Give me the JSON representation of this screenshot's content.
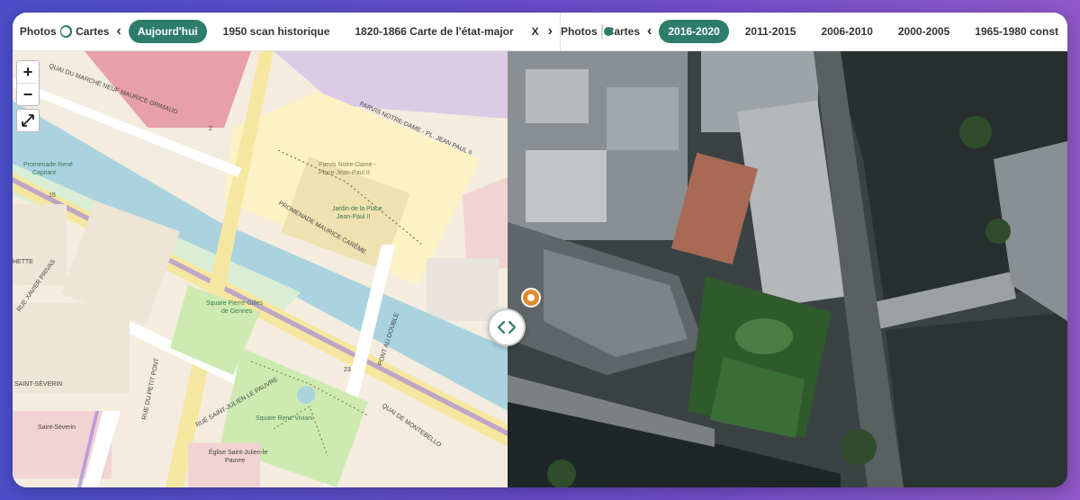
{
  "left_toolbar": {
    "photos_label": "Photos",
    "cartes_label": "Cartes",
    "tabs": [
      {
        "label": "Aujourd'hui",
        "active": true
      },
      {
        "label": "1950 scan historique",
        "active": false
      },
      {
        "label": "1820-1866 Carte de l'état-major",
        "active": false
      },
      {
        "label": "X",
        "active": false
      }
    ]
  },
  "right_toolbar": {
    "photos_label": "Photos",
    "cartes_label": "Cartes",
    "tabs": [
      {
        "label": "2016-2020",
        "active": true
      },
      {
        "label": "2011-2015",
        "active": false
      },
      {
        "label": "2006-2010",
        "active": false
      },
      {
        "label": "2000-2005",
        "active": false
      },
      {
        "label": "1965-1980 const",
        "active": false
      }
    ]
  },
  "map_controls": {
    "zoom_in": "+",
    "zoom_out": "−"
  },
  "map_labels": {
    "quai_marche_neuf": "QUAI DU MARCHÉ NEUF MAURICE GRIMAUD",
    "parvis": "PARVIS NOTRE-DAME - PL. JEAN PAUL II",
    "parvis_place_1": "Parvis Notre-Dame -",
    "parvis_place_2": "Place Jean-Paul II",
    "jardin_1": "Jardin de la Place",
    "jardin_2": "Jean-Paul II",
    "promenade_carene": "PROMENADE MAURICE CARÊME",
    "promenade_rene_1": "Promenade René",
    "promenade_rene_2": "Capitant",
    "rue_petit_pont": "RUE DU PETIT PONT",
    "rue_st_julien": "RUE SAINT-JULIEN LE PAUVRE",
    "square_gilles_1": "Square Pierre-Gilles",
    "square_gilles_2": "de Gennes",
    "square_viviani": "Square René Viviani",
    "pont_double": "PONT AU DOUBLE",
    "quai_montebello": "QUAI DE MONTEBELLO",
    "huchette": "HETTE",
    "rue_prouvaires": "RUE XAVIER PRIVAS",
    "saint_severin": "SAINT-SÉVERIN",
    "saint_severin_church": "Saint-Séverin",
    "eglise_1": "Église Saint-Julien-le",
    "eglise_2": "Pauvre",
    "num_15": "15",
    "num_2": "2",
    "num_23": "23"
  },
  "colors": {
    "accent": "#2e7d6b",
    "river": "#aad3df",
    "land": "#f4ecdf",
    "park": "#cdebb0",
    "square": "#fdf2c3",
    "building_red": "#e8a0a8",
    "building_purple": "#dccbe6"
  }
}
